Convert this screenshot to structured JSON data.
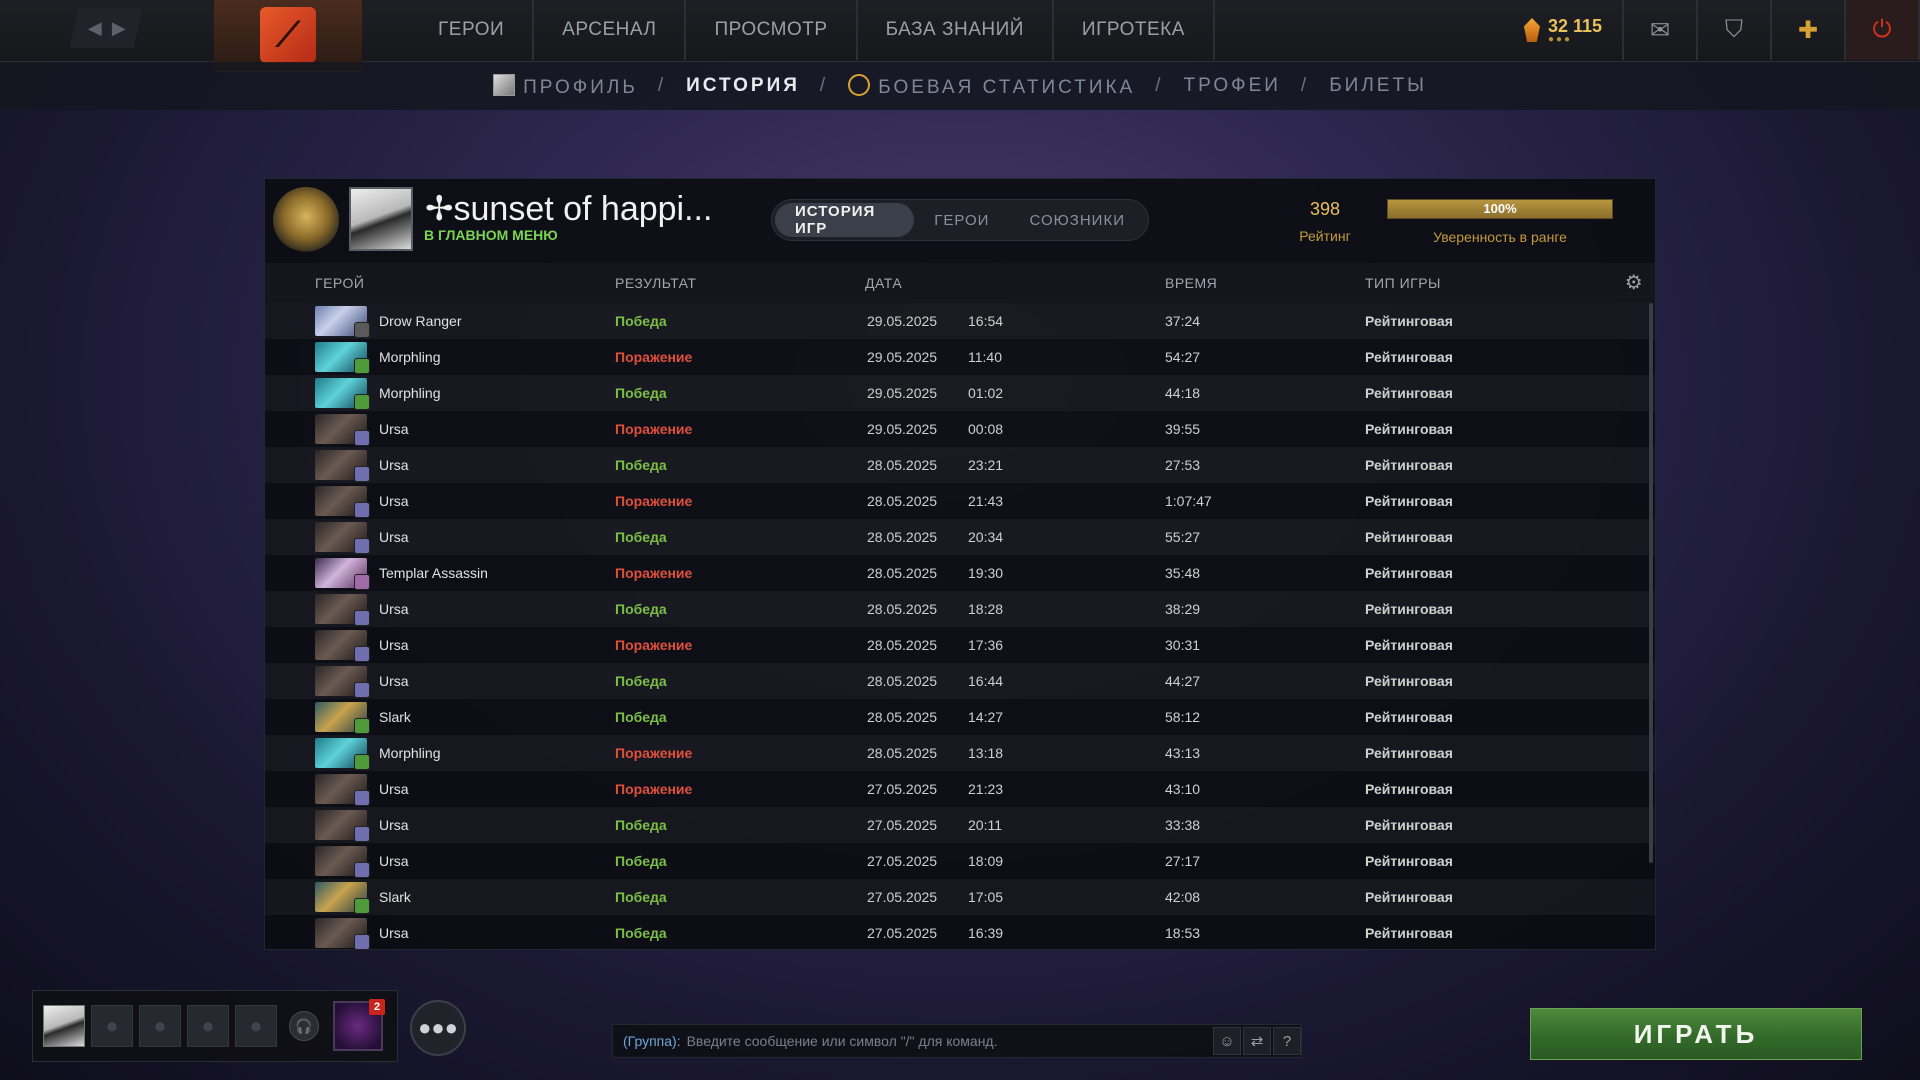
{
  "topbar": {
    "nav": [
      "ГЕРОИ",
      "АРСЕНАЛ",
      "ПРОСМОТР",
      "БАЗА ЗНАНИЙ",
      "ИГРОТЕКА"
    ],
    "shards": "32 115"
  },
  "subnav": {
    "profile": "ПРОФИЛЬ",
    "history": "ИСТОРИЯ",
    "battle_stats": "БОЕВАЯ СТАТИСТИКА",
    "trophies": "ТРОФЕИ",
    "tickets": "БИЛЕТЫ",
    "separator": "/"
  },
  "player": {
    "name": "sunset of happi...",
    "status": "В ГЛАВНОМ МЕНЮ"
  },
  "tabs": [
    "ИСТОРИЯ ИГР",
    "ГЕРОИ",
    "СОЮЗНИКИ"
  ],
  "rating": {
    "value": "398",
    "label": "Рейтинг",
    "confidence_text": "100%",
    "confidence_level": 1.0,
    "confidence_label": "Уверенность в ранге"
  },
  "columns": {
    "hero": "ГЕРОЙ",
    "result": "РЕЗУЛЬТАТ",
    "date": "ДАТА",
    "time": "ВРЕМЯ",
    "type": "ТИП ИГРЫ"
  },
  "matches": [
    {
      "hero": "Drow Ranger",
      "result": "Победа",
      "win": true,
      "date": "29.05.2025",
      "start": "16:54",
      "duration": "37:24",
      "type": "Рейтинговая"
    },
    {
      "hero": "Morphling",
      "result": "Поражение",
      "win": false,
      "date": "29.05.2025",
      "start": "11:40",
      "duration": "54:27",
      "type": "Рейтинговая"
    },
    {
      "hero": "Morphling",
      "result": "Победа",
      "win": true,
      "date": "29.05.2025",
      "start": "01:02",
      "duration": "44:18",
      "type": "Рейтинговая"
    },
    {
      "hero": "Ursa",
      "result": "Поражение",
      "win": false,
      "date": "29.05.2025",
      "start": "00:08",
      "duration": "39:55",
      "type": "Рейтинговая"
    },
    {
      "hero": "Ursa",
      "result": "Победа",
      "win": true,
      "date": "28.05.2025",
      "start": "23:21",
      "duration": "27:53",
      "type": "Рейтинговая"
    },
    {
      "hero": "Ursa",
      "result": "Поражение",
      "win": false,
      "date": "28.05.2025",
      "start": "21:43",
      "duration": "1:07:47",
      "type": "Рейтинговая"
    },
    {
      "hero": "Ursa",
      "result": "Победа",
      "win": true,
      "date": "28.05.2025",
      "start": "20:34",
      "duration": "55:27",
      "type": "Рейтинговая"
    },
    {
      "hero": "Templar Assassin",
      "result": "Поражение",
      "win": false,
      "date": "28.05.2025",
      "start": "19:30",
      "duration": "35:48",
      "type": "Рейтинговая"
    },
    {
      "hero": "Ursa",
      "result": "Победа",
      "win": true,
      "date": "28.05.2025",
      "start": "18:28",
      "duration": "38:29",
      "type": "Рейтинговая"
    },
    {
      "hero": "Ursa",
      "result": "Поражение",
      "win": false,
      "date": "28.05.2025",
      "start": "17:36",
      "duration": "30:31",
      "type": "Рейтинговая"
    },
    {
      "hero": "Ursa",
      "result": "Победа",
      "win": true,
      "date": "28.05.2025",
      "start": "16:44",
      "duration": "44:27",
      "type": "Рейтинговая"
    },
    {
      "hero": "Slark",
      "result": "Победа",
      "win": true,
      "date": "28.05.2025",
      "start": "14:27",
      "duration": "58:12",
      "type": "Рейтинговая"
    },
    {
      "hero": "Morphling",
      "result": "Поражение",
      "win": false,
      "date": "28.05.2025",
      "start": "13:18",
      "duration": "43:13",
      "type": "Рейтинговая"
    },
    {
      "hero": "Ursa",
      "result": "Поражение",
      "win": false,
      "date": "27.05.2025",
      "start": "21:23",
      "duration": "43:10",
      "type": "Рейтинговая"
    },
    {
      "hero": "Ursa",
      "result": "Победа",
      "win": true,
      "date": "27.05.2025",
      "start": "20:11",
      "duration": "33:38",
      "type": "Рейтинговая"
    },
    {
      "hero": "Ursa",
      "result": "Победа",
      "win": true,
      "date": "27.05.2025",
      "start": "18:09",
      "duration": "27:17",
      "type": "Рейтинговая"
    },
    {
      "hero": "Slark",
      "result": "Победа",
      "win": true,
      "date": "27.05.2025",
      "start": "17:05",
      "duration": "42:08",
      "type": "Рейтинговая"
    },
    {
      "hero": "Ursa",
      "result": "Победа",
      "win": true,
      "date": "27.05.2025",
      "start": "16:39",
      "duration": "18:53",
      "type": "Рейтинговая"
    }
  ],
  "party": {
    "notification_count": "2"
  },
  "chat": {
    "group_label": "(Группа):",
    "placeholder": "Введите сообщение или символ \"/\" для команд.",
    "help": "?"
  },
  "play_button": "ИГРАТЬ",
  "colors": {
    "win": "#7bbf45",
    "loss": "#e0503b",
    "accent_gold": "#e8c15b",
    "status_green": "#7bd451"
  }
}
